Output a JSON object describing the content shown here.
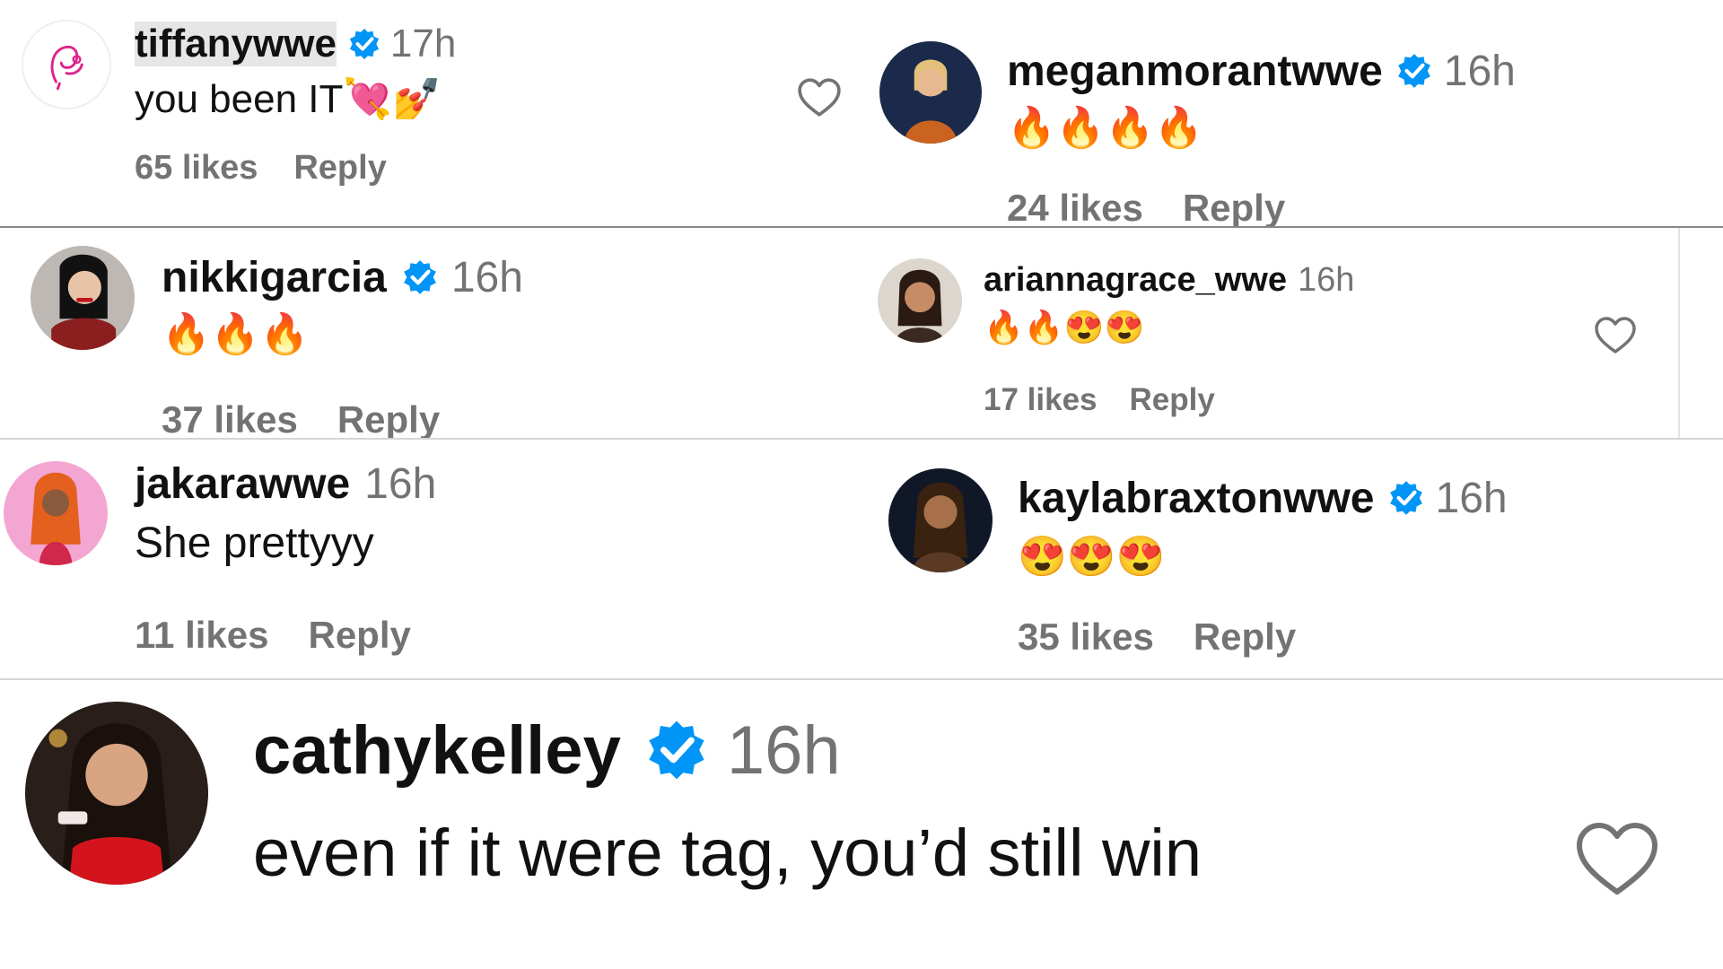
{
  "comments": [
    {
      "username": "tiffanywwe",
      "verified": true,
      "time": "17h",
      "text": "you been IT",
      "text_emoji": "💘💅",
      "likes": "65 likes",
      "reply": "Reply"
    },
    {
      "username": "meganmorantwwe",
      "verified": true,
      "time": "16h",
      "emoji": "🔥🔥🔥🔥",
      "likes": "24 likes",
      "reply": "Reply"
    },
    {
      "username": "nikkigarcia",
      "verified": true,
      "time": "16h",
      "emoji": "🔥🔥🔥",
      "likes": "37 likes",
      "reply": "Reply"
    },
    {
      "username": "ariannagrace_wwe",
      "verified": false,
      "time": "16h",
      "emoji": "🔥🔥😍😍",
      "likes": "17 likes",
      "reply": "Reply"
    },
    {
      "username": "jakarawwe",
      "verified": false,
      "time": "16h",
      "text": "She prettyyy",
      "likes": "11 likes",
      "reply": "Reply"
    },
    {
      "username": "kaylabraxtonwwe",
      "verified": true,
      "time": "16h",
      "emoji": "😍😍😍",
      "likes": "35 likes",
      "reply": "Reply"
    },
    {
      "username": "cathykelley",
      "verified": true,
      "time": "16h",
      "text": "even if it were tag, you’d still win"
    }
  ],
  "icons": {
    "verified": "verified-badge-icon",
    "like": "heart-outline-icon"
  },
  "colors": {
    "verified_blue": "#0095f6",
    "secondary_text": "#737373",
    "primary_text": "#111111"
  }
}
